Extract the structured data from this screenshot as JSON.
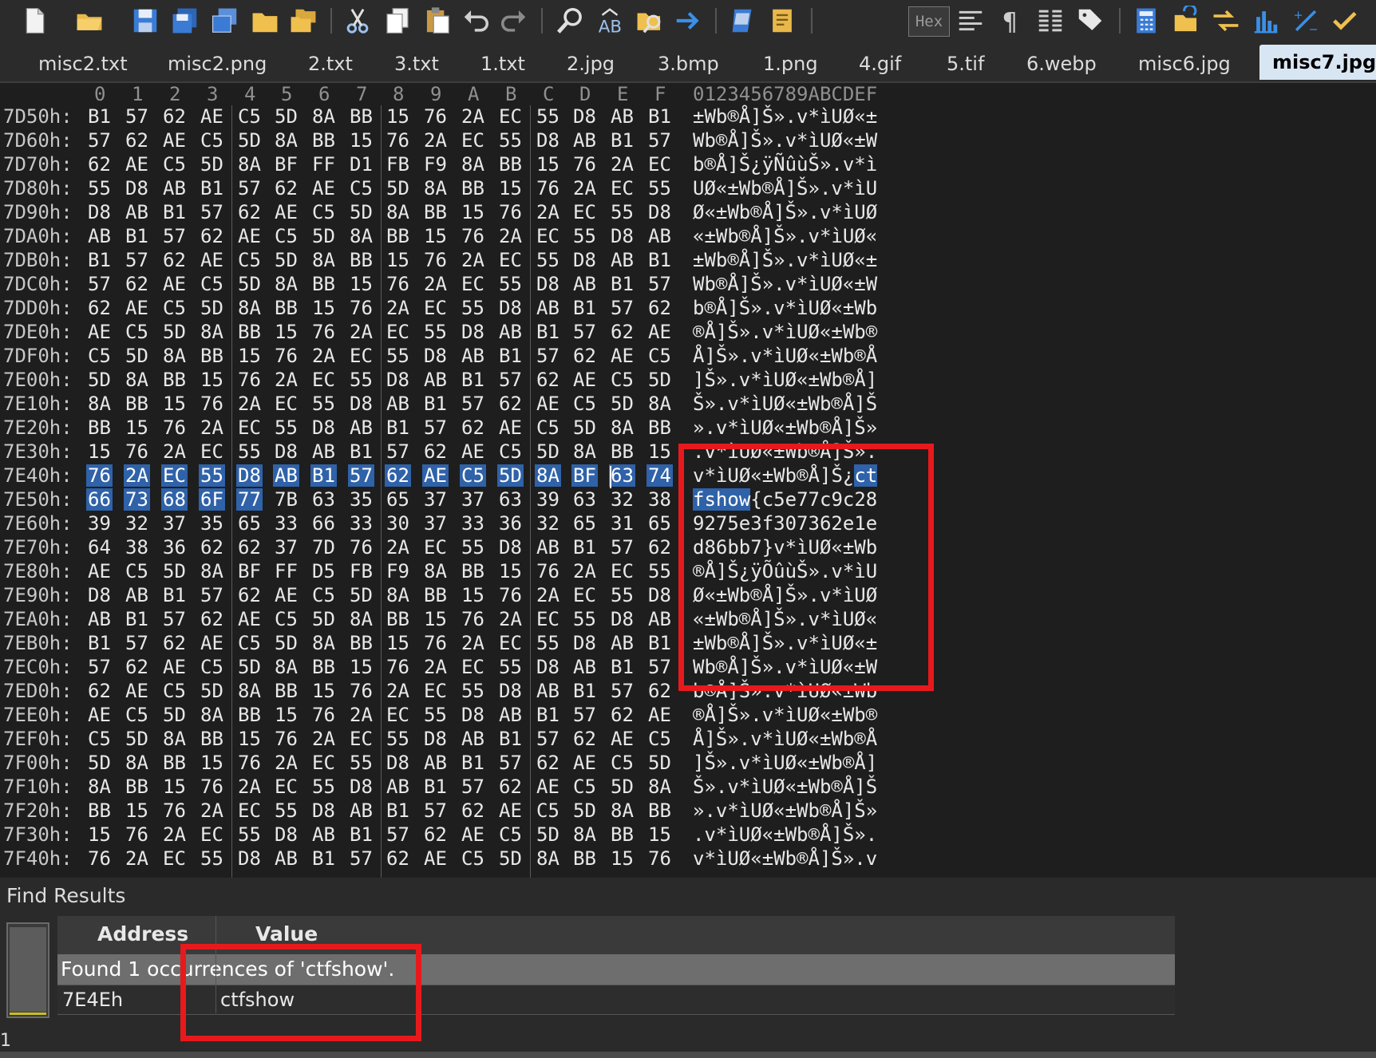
{
  "toolbar": {
    "hex_label": "Hex",
    "icons": [
      "new-file-icon",
      "open-folder-icon",
      "save-icon",
      "save-all-icon",
      "copy-window-icon",
      "folder-icon",
      "open-folders-icon",
      "cut-icon",
      "copy-icon",
      "paste-icon",
      "undo-icon",
      "redo-icon",
      "find-icon",
      "replace-icon",
      "find-in-files-icon",
      "goto-icon",
      "toggle-panel-icon",
      "scroll-icon",
      "hex-mode",
      "align-icon",
      "pilcrow-icon",
      "columns-icon",
      "tag-icon",
      "calculator-icon",
      "macro-icon",
      "swap-icon",
      "histogram-icon",
      "percent-icon",
      "check-icon"
    ]
  },
  "tabs": [
    {
      "label": "misc2.txt",
      "active": false
    },
    {
      "label": "misc2.png",
      "active": false
    },
    {
      "label": "2.txt",
      "active": false
    },
    {
      "label": "3.txt",
      "active": false
    },
    {
      "label": "1.txt",
      "active": false
    },
    {
      "label": "2.jpg",
      "active": false
    },
    {
      "label": "3.bmp",
      "active": false
    },
    {
      "label": "1.png",
      "active": false
    },
    {
      "label": "4.gif",
      "active": false
    },
    {
      "label": "5.tif",
      "active": false
    },
    {
      "label": "6.webp",
      "active": false
    },
    {
      "label": "misc6.jpg",
      "active": false
    },
    {
      "label": "misc7.jpg",
      "active": true
    }
  ],
  "hex": {
    "column_headers": [
      "0",
      "1",
      "2",
      "3",
      "4",
      "5",
      "6",
      "7",
      "8",
      "9",
      "A",
      "B",
      "C",
      "D",
      "E",
      "F"
    ],
    "ascii_header": "0123456789ABCDEF",
    "rows": [
      {
        "addr": "7D50h:",
        "bytes": [
          "B1",
          "57",
          "62",
          "AE",
          "C5",
          "5D",
          "8A",
          "BB",
          "15",
          "76",
          "2A",
          "EC",
          "55",
          "D8",
          "AB",
          "B1"
        ],
        "ascii": "±Wb®Å]Š».v*ìUØ«±"
      },
      {
        "addr": "7D60h:",
        "bytes": [
          "57",
          "62",
          "AE",
          "C5",
          "5D",
          "8A",
          "BB",
          "15",
          "76",
          "2A",
          "EC",
          "55",
          "D8",
          "AB",
          "B1",
          "57"
        ],
        "ascii": "Wb®Å]Š».v*ìUØ«±W"
      },
      {
        "addr": "7D70h:",
        "bytes": [
          "62",
          "AE",
          "C5",
          "5D",
          "8A",
          "BF",
          "FF",
          "D1",
          "FB",
          "F9",
          "8A",
          "BB",
          "15",
          "76",
          "2A",
          "EC"
        ],
        "ascii": "b®Å]Š¿ÿÑûùŠ».v*ì"
      },
      {
        "addr": "7D80h:",
        "bytes": [
          "55",
          "D8",
          "AB",
          "B1",
          "57",
          "62",
          "AE",
          "C5",
          "5D",
          "8A",
          "BB",
          "15",
          "76",
          "2A",
          "EC",
          "55"
        ],
        "ascii": "UØ«±Wb®Å]Š».v*ìU"
      },
      {
        "addr": "7D90h:",
        "bytes": [
          "D8",
          "AB",
          "B1",
          "57",
          "62",
          "AE",
          "C5",
          "5D",
          "8A",
          "BB",
          "15",
          "76",
          "2A",
          "EC",
          "55",
          "D8"
        ],
        "ascii": "Ø«±Wb®Å]Š».v*ìUØ"
      },
      {
        "addr": "7DA0h:",
        "bytes": [
          "AB",
          "B1",
          "57",
          "62",
          "AE",
          "C5",
          "5D",
          "8A",
          "BB",
          "15",
          "76",
          "2A",
          "EC",
          "55",
          "D8",
          "AB"
        ],
        "ascii": "«±Wb®Å]Š».v*ìUØ«"
      },
      {
        "addr": "7DB0h:",
        "bytes": [
          "B1",
          "57",
          "62",
          "AE",
          "C5",
          "5D",
          "8A",
          "BB",
          "15",
          "76",
          "2A",
          "EC",
          "55",
          "D8",
          "AB",
          "B1"
        ],
        "ascii": "±Wb®Å]Š».v*ìUØ«±"
      },
      {
        "addr": "7DC0h:",
        "bytes": [
          "57",
          "62",
          "AE",
          "C5",
          "5D",
          "8A",
          "BB",
          "15",
          "76",
          "2A",
          "EC",
          "55",
          "D8",
          "AB",
          "B1",
          "57"
        ],
        "ascii": "Wb®Å]Š».v*ìUØ«±W"
      },
      {
        "addr": "7DD0h:",
        "bytes": [
          "62",
          "AE",
          "C5",
          "5D",
          "8A",
          "BB",
          "15",
          "76",
          "2A",
          "EC",
          "55",
          "D8",
          "AB",
          "B1",
          "57",
          "62"
        ],
        "ascii": "b®Å]Š».v*ìUØ«±Wb"
      },
      {
        "addr": "7DE0h:",
        "bytes": [
          "AE",
          "C5",
          "5D",
          "8A",
          "BB",
          "15",
          "76",
          "2A",
          "EC",
          "55",
          "D8",
          "AB",
          "B1",
          "57",
          "62",
          "AE"
        ],
        "ascii": "®Å]Š».v*ìUØ«±Wb®"
      },
      {
        "addr": "7DF0h:",
        "bytes": [
          "C5",
          "5D",
          "8A",
          "BB",
          "15",
          "76",
          "2A",
          "EC",
          "55",
          "D8",
          "AB",
          "B1",
          "57",
          "62",
          "AE",
          "C5"
        ],
        "ascii": "Å]Š».v*ìUØ«±Wb®Å"
      },
      {
        "addr": "7E00h:",
        "bytes": [
          "5D",
          "8A",
          "BB",
          "15",
          "76",
          "2A",
          "EC",
          "55",
          "D8",
          "AB",
          "B1",
          "57",
          "62",
          "AE",
          "C5",
          "5D"
        ],
        "ascii": "]Š».v*ìUØ«±Wb®Å]"
      },
      {
        "addr": "7E10h:",
        "bytes": [
          "8A",
          "BB",
          "15",
          "76",
          "2A",
          "EC",
          "55",
          "D8",
          "AB",
          "B1",
          "57",
          "62",
          "AE",
          "C5",
          "5D",
          "8A"
        ],
        "ascii": "Š».v*ìUØ«±Wb®Å]Š"
      },
      {
        "addr": "7E20h:",
        "bytes": [
          "BB",
          "15",
          "76",
          "2A",
          "EC",
          "55",
          "D8",
          "AB",
          "B1",
          "57",
          "62",
          "AE",
          "C5",
          "5D",
          "8A",
          "BB"
        ],
        "ascii": "».v*ìUØ«±Wb®Å]Š»"
      },
      {
        "addr": "7E30h:",
        "bytes": [
          "15",
          "76",
          "2A",
          "EC",
          "55",
          "D8",
          "AB",
          "B1",
          "57",
          "62",
          "AE",
          "C5",
          "5D",
          "8A",
          "BB",
          "15"
        ],
        "ascii": ".v*ìUØ«±Wb®Å]Š»."
      },
      {
        "addr": "7E40h:",
        "bytes": [
          "76",
          "2A",
          "EC",
          "55",
          "D8",
          "AB",
          "B1",
          "57",
          "62",
          "AE",
          "C5",
          "5D",
          "8A",
          "BF",
          "63",
          "74"
        ],
        "ascii": "v*ìUØ«±Wb®Å]Š¿ct"
      },
      {
        "addr": "7E50h:",
        "bytes": [
          "66",
          "73",
          "68",
          "6F",
          "77",
          "7B",
          "63",
          "35",
          "65",
          "37",
          "37",
          "63",
          "39",
          "63",
          "32",
          "38"
        ],
        "ascii": "fshow{c5e77c9c28"
      },
      {
        "addr": "7E60h:",
        "bytes": [
          "39",
          "32",
          "37",
          "35",
          "65",
          "33",
          "66",
          "33",
          "30",
          "37",
          "33",
          "36",
          "32",
          "65",
          "31",
          "65"
        ],
        "ascii": "9275e3f307362e1e"
      },
      {
        "addr": "7E70h:",
        "bytes": [
          "64",
          "38",
          "36",
          "62",
          "62",
          "37",
          "7D",
          "76",
          "2A",
          "EC",
          "55",
          "D8",
          "AB",
          "B1",
          "57",
          "62"
        ],
        "ascii": "d86bb7}v*ìUØ«±Wb"
      },
      {
        "addr": "7E80h:",
        "bytes": [
          "AE",
          "C5",
          "5D",
          "8A",
          "BF",
          "FF",
          "D5",
          "FB",
          "F9",
          "8A",
          "BB",
          "15",
          "76",
          "2A",
          "EC",
          "55"
        ],
        "ascii": "®Å]Š¿ÿÕûùŠ».v*ìU"
      },
      {
        "addr": "7E90h:",
        "bytes": [
          "D8",
          "AB",
          "B1",
          "57",
          "62",
          "AE",
          "C5",
          "5D",
          "8A",
          "BB",
          "15",
          "76",
          "2A",
          "EC",
          "55",
          "D8"
        ],
        "ascii": "Ø«±Wb®Å]Š».v*ìUØ"
      },
      {
        "addr": "7EA0h:",
        "bytes": [
          "AB",
          "B1",
          "57",
          "62",
          "AE",
          "C5",
          "5D",
          "8A",
          "BB",
          "15",
          "76",
          "2A",
          "EC",
          "55",
          "D8",
          "AB"
        ],
        "ascii": "«±Wb®Å]Š».v*ìUØ«"
      },
      {
        "addr": "7EB0h:",
        "bytes": [
          "B1",
          "57",
          "62",
          "AE",
          "C5",
          "5D",
          "8A",
          "BB",
          "15",
          "76",
          "2A",
          "EC",
          "55",
          "D8",
          "AB",
          "B1"
        ],
        "ascii": "±Wb®Å]Š».v*ìUØ«±"
      },
      {
        "addr": "7EC0h:",
        "bytes": [
          "57",
          "62",
          "AE",
          "C5",
          "5D",
          "8A",
          "BB",
          "15",
          "76",
          "2A",
          "EC",
          "55",
          "D8",
          "AB",
          "B1",
          "57"
        ],
        "ascii": "Wb®Å]Š».v*ìUØ«±W"
      },
      {
        "addr": "7ED0h:",
        "bytes": [
          "62",
          "AE",
          "C5",
          "5D",
          "8A",
          "BB",
          "15",
          "76",
          "2A",
          "EC",
          "55",
          "D8",
          "AB",
          "B1",
          "57",
          "62"
        ],
        "ascii": "b®Å]Š».v*ìUØ«±Wb"
      },
      {
        "addr": "7EE0h:",
        "bytes": [
          "AE",
          "C5",
          "5D",
          "8A",
          "BB",
          "15",
          "76",
          "2A",
          "EC",
          "55",
          "D8",
          "AB",
          "B1",
          "57",
          "62",
          "AE"
        ],
        "ascii": "®Å]Š».v*ìUØ«±Wb®"
      },
      {
        "addr": "7EF0h:",
        "bytes": [
          "C5",
          "5D",
          "8A",
          "BB",
          "15",
          "76",
          "2A",
          "EC",
          "55",
          "D8",
          "AB",
          "B1",
          "57",
          "62",
          "AE",
          "C5"
        ],
        "ascii": "Å]Š».v*ìUØ«±Wb®Å"
      },
      {
        "addr": "7F00h:",
        "bytes": [
          "5D",
          "8A",
          "BB",
          "15",
          "76",
          "2A",
          "EC",
          "55",
          "D8",
          "AB",
          "B1",
          "57",
          "62",
          "AE",
          "C5",
          "5D"
        ],
        "ascii": "]Š».v*ìUØ«±Wb®Å]"
      },
      {
        "addr": "7F10h:",
        "bytes": [
          "8A",
          "BB",
          "15",
          "76",
          "2A",
          "EC",
          "55",
          "D8",
          "AB",
          "B1",
          "57",
          "62",
          "AE",
          "C5",
          "5D",
          "8A"
        ],
        "ascii": "Š».v*ìUØ«±Wb®Å]Š"
      },
      {
        "addr": "7F20h:",
        "bytes": [
          "BB",
          "15",
          "76",
          "2A",
          "EC",
          "55",
          "D8",
          "AB",
          "B1",
          "57",
          "62",
          "AE",
          "C5",
          "5D",
          "8A",
          "BB"
        ],
        "ascii": "».v*ìUØ«±Wb®Å]Š»"
      },
      {
        "addr": "7F30h:",
        "bytes": [
          "15",
          "76",
          "2A",
          "EC",
          "55",
          "D8",
          "AB",
          "B1",
          "57",
          "62",
          "AE",
          "C5",
          "5D",
          "8A",
          "BB",
          "15"
        ],
        "ascii": ".v*ìUØ«±Wb®Å]Š»."
      },
      {
        "addr": "7F40h:",
        "bytes": [
          "76",
          "2A",
          "EC",
          "55",
          "D8",
          "AB",
          "B1",
          "57",
          "62",
          "AE",
          "C5",
          "5D",
          "8A",
          "BB",
          "15",
          "76"
        ],
        "ascii": "v*ìUØ«±Wb®Å]Š».v"
      }
    ]
  },
  "find": {
    "title": "Find Results",
    "col_address": "Address",
    "col_value": "Value",
    "summary": "Found 1 occurrences of 'ctfshow'.",
    "result_address": "7E4Eh",
    "result_value": "ctfshow",
    "count": "1"
  },
  "colors": {
    "selection": "#2f62a8",
    "annotation": "#e8191c",
    "active_tab": "#d8e6f3"
  }
}
